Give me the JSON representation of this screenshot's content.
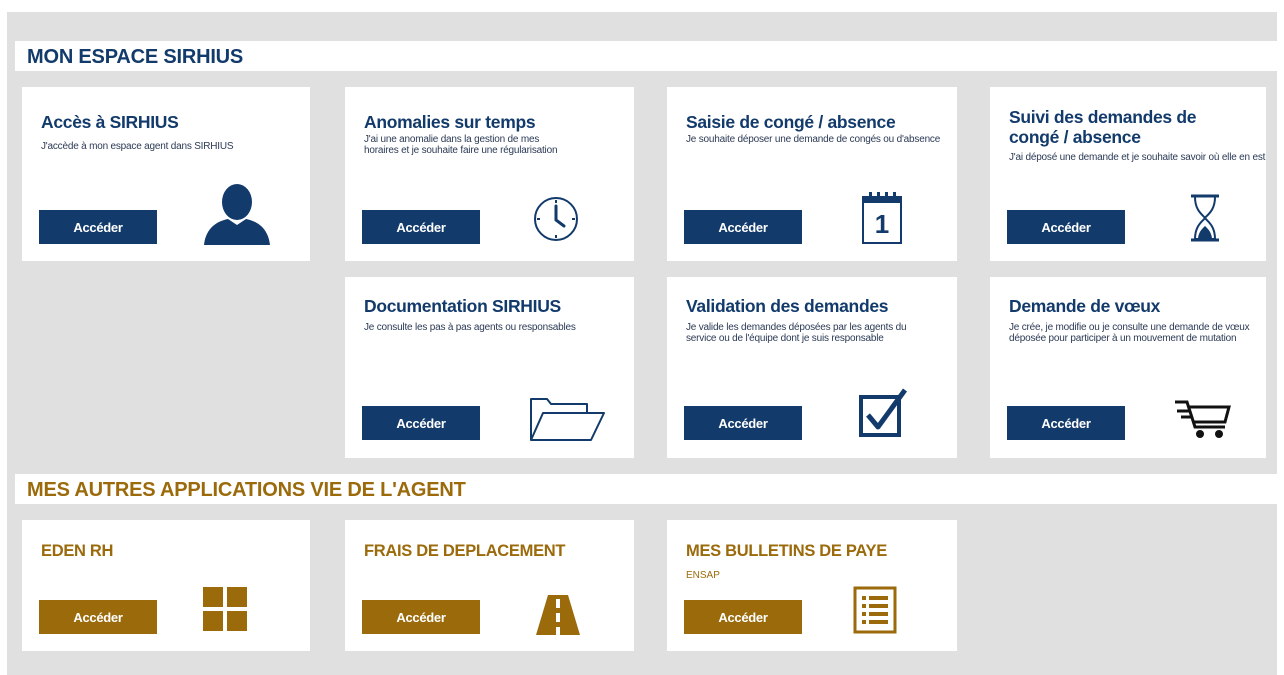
{
  "sections": {
    "sirhius_title": "MON ESPACE SIRHIUS",
    "other_apps_title": "MES AUTRES APPLICATIONS VIE DE L'AGENT"
  },
  "button_label": "Accéder",
  "cards": {
    "acces": {
      "title": "Accès à SIRHIUS",
      "desc": "J'accède à mon espace agent dans SIRHIUS",
      "icon": "user-icon"
    },
    "anomalies": {
      "title": "Anomalies sur temps",
      "desc": "J'ai une anomalie dans la gestion de mes horaires et je souhaite faire une régularisation",
      "icon": "clock-icon"
    },
    "saisie": {
      "title": "Saisie de congé / absence",
      "desc": "Je souhaite déposer une demande de congés ou d'absence",
      "icon": "calendar-icon",
      "calendar_day": "1"
    },
    "suivi": {
      "title": "Suivi des demandes de congé / absence",
      "desc": "J'ai déposé une demande et je souhaite savoir où elle en est",
      "icon": "hourglass-icon"
    },
    "documentation": {
      "title": "Documentation SIRHIUS",
      "desc": "Je consulte les pas à pas agents ou responsables",
      "icon": "folder-icon"
    },
    "validation": {
      "title": "Validation des demandes",
      "desc": "Je valide les demandes déposées par les agents du service ou de l'équipe dont je suis responsable",
      "icon": "checkbox-icon"
    },
    "voeux": {
      "title": "Demande de vœux",
      "desc": "Je crée, je modifie ou je consulte une demande de vœux déposée pour participer à un mouvement de mutation",
      "icon": "cart-icon"
    },
    "eden": {
      "title": "EDEN RH",
      "icon": "grid-icon"
    },
    "frais": {
      "title": "FRAIS DE DEPLACEMENT",
      "icon": "road-icon"
    },
    "bulletins": {
      "title": "MES BULLETINS DE PAYE",
      "sub": "ENSAP",
      "icon": "document-list-icon"
    }
  },
  "colors": {
    "navy": "#123a6b",
    "gold": "#9b6a0b",
    "background": "#e0e0e0"
  }
}
